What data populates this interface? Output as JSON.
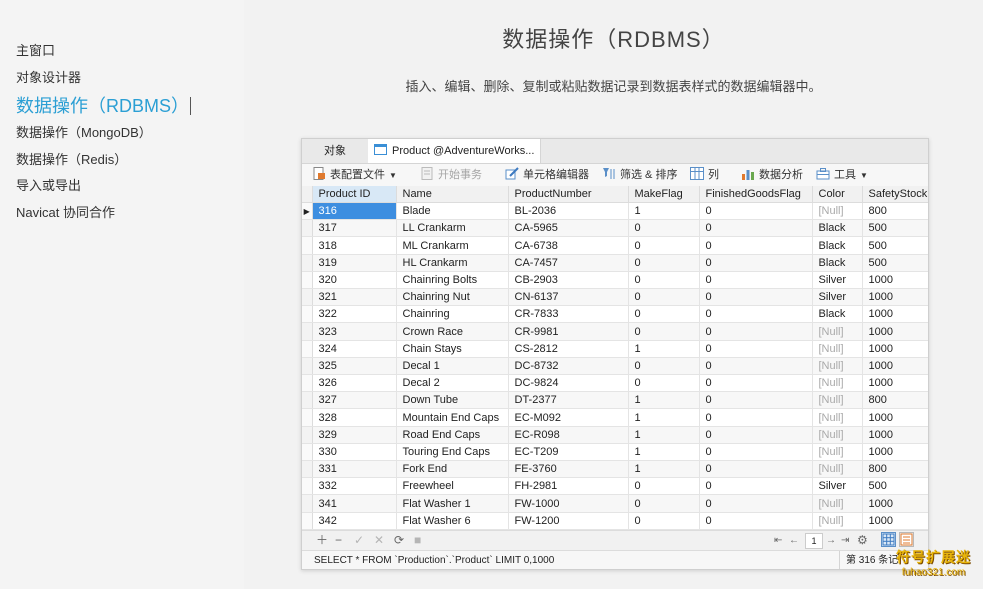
{
  "sidebar": {
    "items": [
      {
        "label": "主窗口",
        "active": false
      },
      {
        "label": "对象设计器",
        "active": false
      },
      {
        "label": "数据操作（RDBMS）",
        "active": true
      },
      {
        "label": "数据操作（MongoDB）",
        "active": false
      },
      {
        "label": "数据操作（Redis）",
        "active": false
      },
      {
        "label": "导入或导出",
        "active": false
      },
      {
        "label": "Navicat 协同合作",
        "active": false
      }
    ]
  },
  "main": {
    "title": "数据操作（RDBMS）",
    "description": "插入、编辑、删除、复制或粘贴数据记录到数据表样式的数据编辑器中。"
  },
  "window": {
    "tabs": [
      {
        "label": "对象"
      },
      {
        "label": "Product @AdventureWorks..."
      }
    ],
    "toolbar": {
      "table_config": "表配置文件",
      "begin_transaction": "开始事务",
      "cell_editor": "单元格编辑器",
      "filter_sort": "筛选 & 排序",
      "columns": "列",
      "data_analysis": "数据分析",
      "tools": "工具"
    },
    "columns": [
      "Product ID",
      "Name",
      "ProductNumber",
      "MakeFlag",
      "FinishedGoodsFlag",
      "Color",
      "SafetyStock"
    ],
    "rows": [
      [
        "316",
        "Blade",
        "BL-2036",
        "1",
        "0",
        "[Null]",
        "800"
      ],
      [
        "317",
        "LL Crankarm",
        "CA-5965",
        "0",
        "0",
        "Black",
        "500"
      ],
      [
        "318",
        "ML Crankarm",
        "CA-6738",
        "0",
        "0",
        "Black",
        "500"
      ],
      [
        "319",
        "HL Crankarm",
        "CA-7457",
        "0",
        "0",
        "Black",
        "500"
      ],
      [
        "320",
        "Chainring Bolts",
        "CB-2903",
        "0",
        "0",
        "Silver",
        "1000"
      ],
      [
        "321",
        "Chainring Nut",
        "CN-6137",
        "0",
        "0",
        "Silver",
        "1000"
      ],
      [
        "322",
        "Chainring",
        "CR-7833",
        "0",
        "0",
        "Black",
        "1000"
      ],
      [
        "323",
        "Crown Race",
        "CR-9981",
        "0",
        "0",
        "[Null]",
        "1000"
      ],
      [
        "324",
        "Chain Stays",
        "CS-2812",
        "1",
        "0",
        "[Null]",
        "1000"
      ],
      [
        "325",
        "Decal 1",
        "DC-8732",
        "0",
        "0",
        "[Null]",
        "1000"
      ],
      [
        "326",
        "Decal 2",
        "DC-9824",
        "0",
        "0",
        "[Null]",
        "1000"
      ],
      [
        "327",
        "Down Tube",
        "DT-2377",
        "1",
        "0",
        "[Null]",
        "800"
      ],
      [
        "328",
        "Mountain End Caps",
        "EC-M092",
        "1",
        "0",
        "[Null]",
        "1000"
      ],
      [
        "329",
        "Road End Caps",
        "EC-R098",
        "1",
        "0",
        "[Null]",
        "1000"
      ],
      [
        "330",
        "Touring End Caps",
        "EC-T209",
        "1",
        "0",
        "[Null]",
        "1000"
      ],
      [
        "331",
        "Fork End",
        "FE-3760",
        "1",
        "0",
        "[Null]",
        "800"
      ],
      [
        "332",
        "Freewheel",
        "FH-2981",
        "0",
        "0",
        "Silver",
        "500"
      ],
      [
        "341",
        "Flat Washer 1",
        "FW-1000",
        "0",
        "0",
        "[Null]",
        "1000"
      ],
      [
        "342",
        "Flat Washer 6",
        "FW-1200",
        "0",
        "0",
        "[Null]",
        "1000"
      ]
    ],
    "bottombar": {
      "page": "1"
    },
    "status": {
      "sql": "SELECT * FROM `Production`.`Product` LIMIT 0,1000",
      "record": "第 316 条记"
    }
  },
  "watermark": {
    "title": "符号扩展迷",
    "url": "fuhao321.com"
  },
  "colors": {
    "accent": "#2b9fd4",
    "selection": "#3d8ee0",
    "null_text": "#a9a9a9"
  }
}
